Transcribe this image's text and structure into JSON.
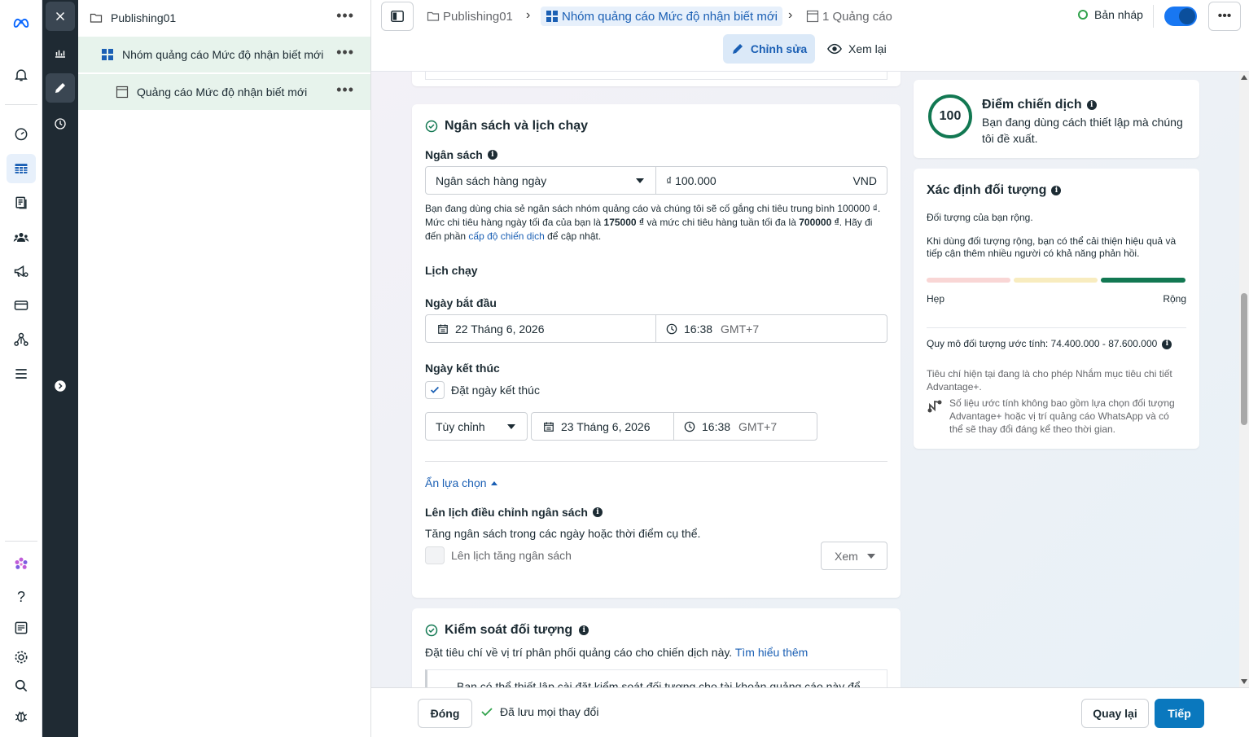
{
  "rail": {
    "icons": [
      "meta-logo-icon",
      "bell-icon",
      "speedometer-icon",
      "table-icon",
      "pages-icon",
      "audience-icon",
      "megaphone-icon",
      "card-icon",
      "network-icon",
      "menu-icon",
      "flower-icon",
      "help-icon",
      "news-icon",
      "settings-icon",
      "search-icon",
      "bug-icon"
    ],
    "help_glyph": "?"
  },
  "tree": {
    "items": [
      {
        "label": "Publishing01",
        "icon": "folder-icon"
      },
      {
        "label": "Nhóm quảng cáo Mức độ nhận biết mới",
        "icon": "grid-icon"
      },
      {
        "label": "Quảng cáo Mức độ nhận biết mới",
        "icon": "ad-icon"
      }
    ],
    "more": "•••"
  },
  "breadcrumb": {
    "campaign": "Publishing01",
    "adset": "Nhóm quảng cáo Mức độ nhận biết mới",
    "ads": "1 Quảng cáo"
  },
  "topbar": {
    "status": "Bản nháp",
    "more": "•••",
    "edit": "Chỉnh sửa",
    "review": "Xem lại"
  },
  "budget": {
    "section_title": "Ngân sách và lịch chạy",
    "budget_label": "Ngân sách",
    "budget_type": "Ngân sách hàng ngày",
    "amount": "₫ 100.000",
    "currency": "VND",
    "note_l1": "Bạn đang dùng chia sẻ ngân sách nhóm quảng cáo và chúng tôi sẽ cố gắng chi tiêu trung bình 100000 ₫.",
    "note_l2_a": "Mức chi tiêu hàng ngày tối đa của bạn là ",
    "note_l2_b": "175000 ₫",
    "note_l2_c": " và mức chi tiêu hàng tuần tối đa là ",
    "note_l2_d": "700000 ₫",
    "note_l2_e": ". Hãy đi",
    "note_l3_a": "đến phần ",
    "note_l3_link": "cấp độ chiến dịch",
    "note_l3_b": " để cập nhật.",
    "schedule_label": "Lịch chạy",
    "start_label": "Ngày bắt đầu",
    "start_date": "22 Tháng 6, 2026",
    "start_time": "16:38",
    "tz": "GMT+7",
    "end_label": "Ngày kết thúc",
    "end_checkbox": "Đặt ngày kết thúc",
    "end_mode": "Tùy chỉnh",
    "end_date": "23 Tháng 6, 2026",
    "end_time": "16:38",
    "hide_options": "Ẩn lựa chọn",
    "rule_label": "Lên lịch điều chỉnh ngân sách",
    "rule_desc": "Tăng ngân sách trong các ngày hoặc thời điểm cụ thể.",
    "rule_checkbox": "Lên lịch tăng ngân sách",
    "view": "Xem"
  },
  "audience_control": {
    "title": "Kiểm soát đối tượng",
    "desc": "Đặt tiêu chí về vị trí phân phối quảng cáo cho chiến dịch này.",
    "link": "Tìm hiểu thêm",
    "note": "Bạn có thể thiết lập cài đặt kiểm soát đối tượng cho tài khoản quảng cáo này để"
  },
  "score": {
    "value": "100",
    "title": "Điểm chiến dịch",
    "desc_l1": "Bạn đang dùng cách thiết lập mà chúng",
    "desc_l2": "tôi đề xuất."
  },
  "audience_def": {
    "title": "Xác định đối tượng",
    "status": "Đối tượng của bạn rộng.",
    "tip_l1": "Khi dùng đối tượng rộng, bạn có thể cải thiện hiệu quả và",
    "tip_l2": "tiếp cận thêm nhiều người có khả năng phản hồi.",
    "narrow": "Hẹp",
    "broad": "Rộng",
    "size": "Quy mô đối tượng ước tính: 74.400.000 - 87.600.000",
    "criteria_l1": "Tiêu chí hiện tại đang là cho phép Nhắm mục tiêu chi tiết",
    "criteria_l2": "Advantage+.",
    "est_l1": "Số liệu ước tính không bao gồm lựa chọn đối tượng",
    "est_l2": "Advantage+ hoặc vị trí quảng cáo WhatsApp và có",
    "est_l3": "thể sẽ thay đổi đáng kể theo thời gian.",
    "colors": {
      "narrow": "#f9d6d5",
      "mid": "#f8ecbf",
      "broad": "#127852"
    }
  },
  "footer": {
    "close": "Đóng",
    "saved": "Đã lưu mọi thay đổi",
    "back": "Quay lại",
    "next": "Tiếp"
  }
}
